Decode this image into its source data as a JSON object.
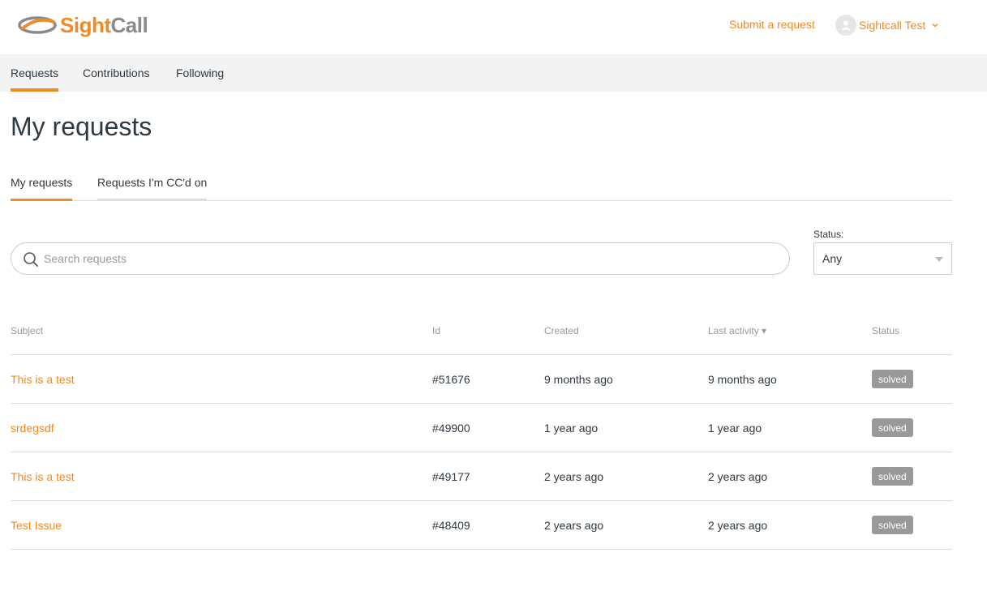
{
  "header": {
    "logo": {
      "text_part1": "Sight",
      "text_part2": "Call",
      "icon": "swoosh-logo-icon"
    },
    "submit_request_label": "Submit a request",
    "user": {
      "name": "Sightcall Test",
      "avatar_icon": "user-avatar-icon",
      "chevron_icon": "chevron-down-icon"
    }
  },
  "subnav": {
    "items": [
      {
        "label": "Requests",
        "active": true
      },
      {
        "label": "Contributions",
        "active": false
      },
      {
        "label": "Following",
        "active": false
      }
    ]
  },
  "page": {
    "title": "My requests"
  },
  "tabs": [
    {
      "label": "My requests",
      "active": true
    },
    {
      "label": "Requests I'm CC'd on",
      "active": false
    }
  ],
  "search": {
    "placeholder": "Search requests",
    "value": "",
    "icon": "search-icon"
  },
  "status_filter": {
    "label": "Status:",
    "selected": "Any"
  },
  "table": {
    "columns": {
      "subject": "Subject",
      "id": "Id",
      "created": "Created",
      "last_activity": "Last activity ▾",
      "status": "Status"
    },
    "rows": [
      {
        "subject": "This is a test",
        "id": "#51676",
        "created": "9 months ago",
        "last_activity": "9 months ago",
        "status": "solved"
      },
      {
        "subject": "srdegsdf",
        "id": "#49900",
        "created": "1 year ago",
        "last_activity": "1 year ago",
        "status": "solved"
      },
      {
        "subject": "This is a test",
        "id": "#49177",
        "created": "2 years ago",
        "last_activity": "2 years ago",
        "status": "solved"
      },
      {
        "subject": "Test Issue",
        "id": "#48409",
        "created": "2 years ago",
        "last_activity": "2 years ago",
        "status": "solved"
      }
    ]
  },
  "colors": {
    "accent": "#f08a24",
    "badge": "#999999",
    "nav_bg": "#f3f3f3"
  }
}
